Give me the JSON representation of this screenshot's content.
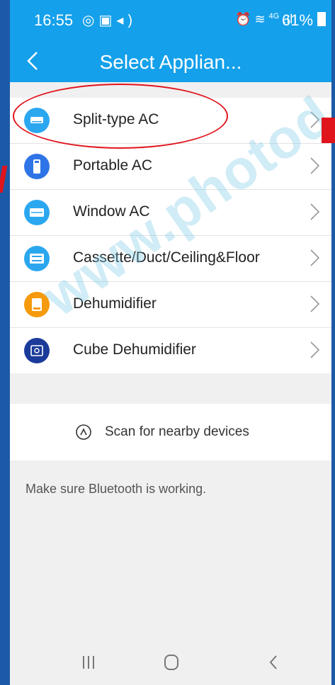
{
  "status_bar": {
    "time": "16:55",
    "battery": "61%",
    "network": "4G"
  },
  "header": {
    "title": "Select Applian..."
  },
  "appliances": [
    {
      "label": "Split-type AC",
      "icon": "split-ac-icon",
      "color": "#2ba7ef"
    },
    {
      "label": "Portable AC",
      "icon": "portable-ac-icon",
      "color": "#2f74e6"
    },
    {
      "label": "Window AC",
      "icon": "window-ac-icon",
      "color": "#2ba7ef"
    },
    {
      "label": "Cassette/Duct/Ceiling&Floor",
      "icon": "cassette-ac-icon",
      "color": "#2ba7ef"
    },
    {
      "label": "Dehumidifier",
      "icon": "dehumidifier-icon",
      "color": "#f59a0c"
    },
    {
      "label": "Cube Dehumidifier",
      "icon": "cube-dehumidifier-icon",
      "color": "#1b3b9a"
    }
  ],
  "scan": {
    "label": "Scan for nearby devices",
    "icon": "bluetooth-scan-icon"
  },
  "hint": "Make sure Bluetooth is working.",
  "watermark": "www.photod.com.ua",
  "colors": {
    "app_bar": "#14a0ea",
    "annotation": "#e0141c",
    "frame": "#1c5aa8"
  }
}
